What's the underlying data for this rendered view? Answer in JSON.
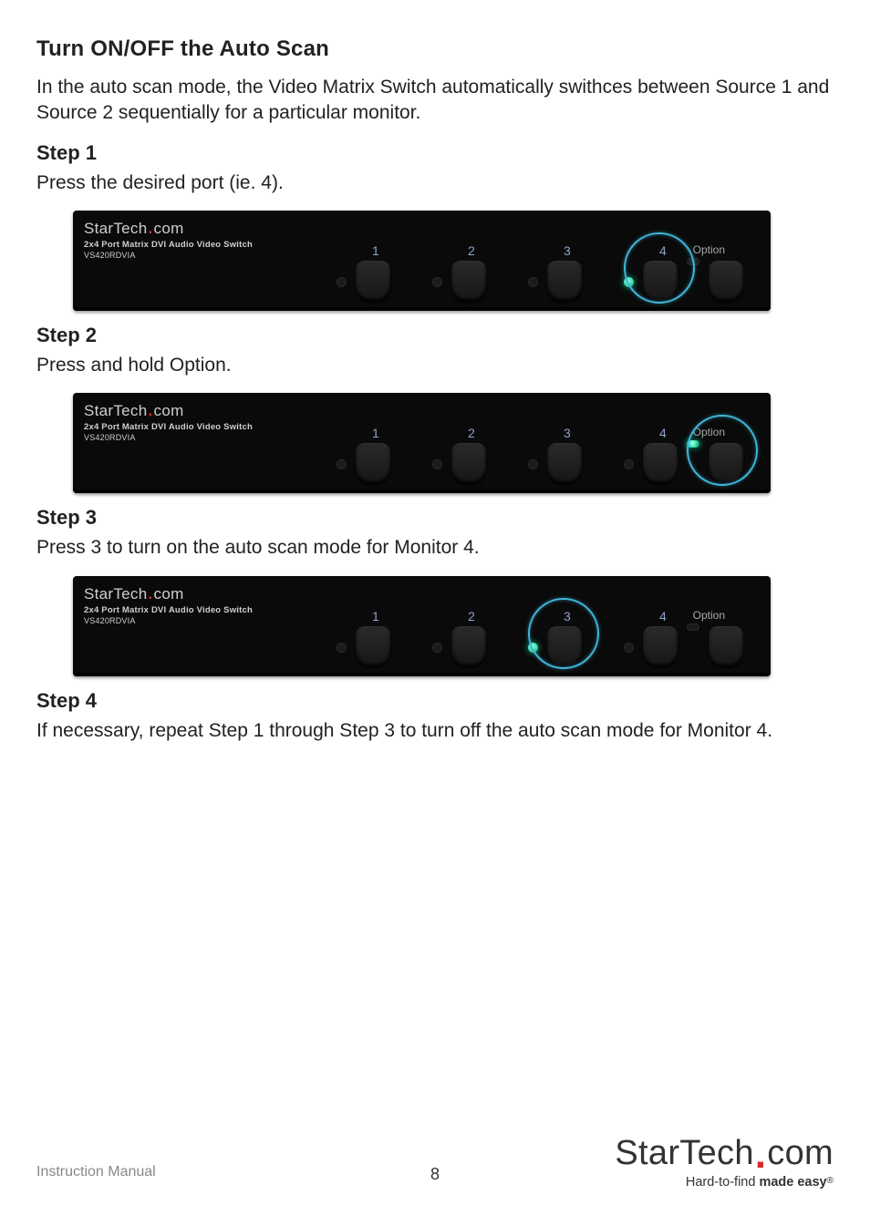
{
  "section_title": "Turn ON/OFF the Auto Scan",
  "section_intro": "In the auto scan mode, the Video Matrix Switch automatically swithces between Source 1 and Source 2 sequentially for a particular monitor.",
  "steps": {
    "s1": {
      "heading": "Step 1",
      "text": "Press the desired port (ie. 4)."
    },
    "s2": {
      "heading": "Step 2",
      "text": "Press and hold Option."
    },
    "s3": {
      "heading": "Step 3",
      "text": "Press 3 to turn on the auto scan mode for Monitor 4."
    },
    "s4": {
      "heading": "Step 4",
      "text": "If necessary, repeat Step 1 through Step 3 to turn off the auto scan mode for Monitor 4."
    }
  },
  "device": {
    "brand_prefix": "StarTech",
    "brand_suffix": "com",
    "product_line": "2x4 Port Matrix DVI Audio Video Switch",
    "model": "VS420RDVIA",
    "ports": {
      "p1": "1",
      "p2": "2",
      "p3": "3",
      "p4": "4"
    },
    "option_label": "Option"
  },
  "panels": {
    "step1": {
      "highlight": "port4",
      "port4_led_on": true,
      "option_led_on": false
    },
    "step2": {
      "highlight": "option",
      "port4_led_on": false,
      "option_led_on": true
    },
    "step3": {
      "highlight": "port3",
      "port3_led_on": true,
      "option_led_on": false
    }
  },
  "footer": {
    "manual_label": "Instruction Manual",
    "page_number": "8",
    "logo_prefix": "StarTech",
    "logo_suffix": "com",
    "tagline_prefix": "Hard-to-find ",
    "tagline_bold": "made easy",
    "tagline_reg": "®"
  }
}
